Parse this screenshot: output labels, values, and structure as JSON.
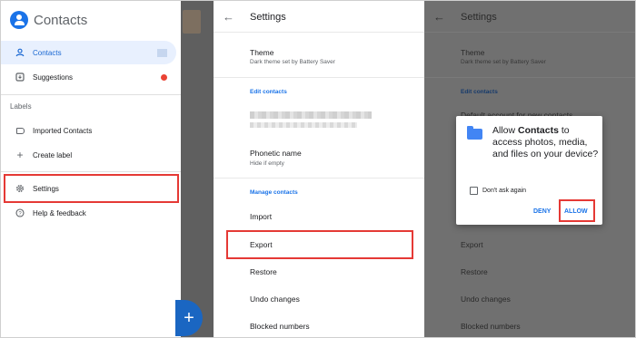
{
  "drawer": {
    "app_name": "Contacts",
    "items": [
      {
        "label": "Contacts",
        "icon": "person-icon"
      },
      {
        "label": "Suggestions",
        "icon": "suggestions-icon"
      }
    ],
    "labels_header": "Labels",
    "label_items": [
      {
        "label": "Imported Contacts",
        "icon": "label-icon"
      },
      {
        "label": "Create label",
        "icon": "plus-icon"
      }
    ],
    "bottom_items": [
      {
        "label": "Settings",
        "icon": "gear-icon"
      },
      {
        "label": "Help & feedback",
        "icon": "help-icon"
      }
    ],
    "fab_symbol": "+"
  },
  "settings": {
    "title": "Settings",
    "theme_title": "Theme",
    "theme_subtitle": "Dark theme set by Battery Saver",
    "edit_contacts_header": "Edit contacts",
    "phonetic_title": "Phonetic name",
    "phonetic_subtitle": "Hide if empty",
    "manage_header": "Manage contacts",
    "manage_items": [
      "Import",
      "Export",
      "Restore",
      "Undo changes",
      "Blocked numbers"
    ]
  },
  "background_settings": {
    "title": "Settings",
    "theme_title": "Theme",
    "theme_subtitle": "Dark theme set by Battery Saver",
    "edit_contacts_header": "Edit contacts",
    "partial_item": "Default account for new contacts",
    "manage_items": [
      "Export",
      "Restore",
      "Undo changes",
      "Blocked numbers"
    ]
  },
  "dialog": {
    "msg_pre": "Allow ",
    "msg_app": "Contacts",
    "msg_post": " to access photos, media, and files on your device?",
    "checkbox_label": "Don't ask again",
    "deny_label": "DENY",
    "allow_label": "ALLOW"
  },
  "colors": {
    "accent": "#1a73e8",
    "highlight_box": "#e53935",
    "badge_red": "#ea4335"
  }
}
